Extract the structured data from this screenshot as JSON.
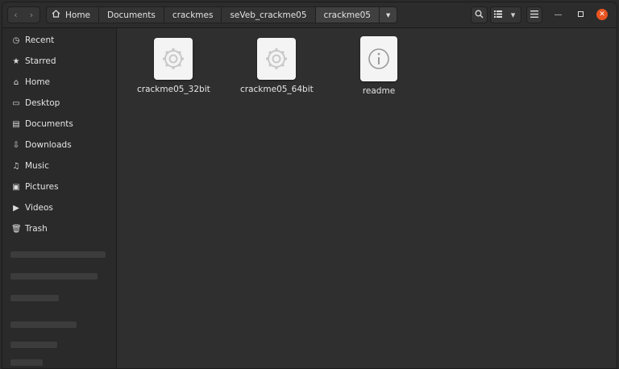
{
  "header": {
    "breadcrumbs": [
      {
        "label": "Home"
      },
      {
        "label": "Documents"
      },
      {
        "label": "crackmes"
      },
      {
        "label": "seVeb_crackme05"
      },
      {
        "label": "crackme05"
      }
    ],
    "icons": {
      "back": "chevron-left-icon",
      "forward": "chevron-right-icon",
      "home": "home-icon",
      "search": "search-icon",
      "view": "list-view-icon",
      "menu": "hamburger-menu-icon"
    },
    "close_color": "#e95420"
  },
  "sidebar": {
    "items": [
      {
        "label": "Recent",
        "icon": "clock-icon"
      },
      {
        "label": "Starred",
        "icon": "star-icon"
      },
      {
        "label": "Home",
        "icon": "home-icon"
      },
      {
        "label": "Desktop",
        "icon": "desktop-icon"
      },
      {
        "label": "Documents",
        "icon": "document-icon"
      },
      {
        "label": "Downloads",
        "icon": "download-icon"
      },
      {
        "label": "Music",
        "icon": "music-note-icon"
      },
      {
        "label": "Pictures",
        "icon": "picture-icon"
      },
      {
        "label": "Videos",
        "icon": "video-icon"
      },
      {
        "label": "Trash",
        "icon": "trash-icon"
      }
    ]
  },
  "files": [
    {
      "name": "crackme05_32bit",
      "icon": "executable-gear-icon"
    },
    {
      "name": "crackme05_64bit",
      "icon": "executable-gear-icon"
    },
    {
      "name": "readme",
      "icon": "info-document-icon"
    }
  ]
}
